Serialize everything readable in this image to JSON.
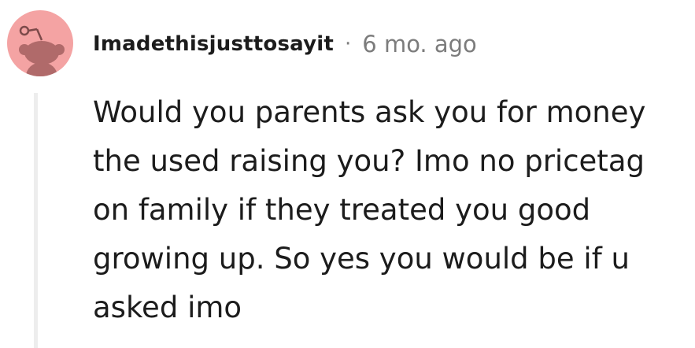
{
  "comment": {
    "username": "Imadethisjusttosayit",
    "separator": "·",
    "timestamp": "6 mo. ago",
    "body": "Would you parents ask you for money the used raising you? Imo no pricetag on family if they treated you good growing up. So yes you would be if u asked imo",
    "avatar_icon": "reddit-snoo-icon"
  },
  "colors": {
    "avatar_background": "#f4a3a3",
    "avatar_figure": "#b06a6a",
    "text": "#1c1c1c",
    "meta_text": "#7c7c7c",
    "thread_line": "#ededed"
  }
}
